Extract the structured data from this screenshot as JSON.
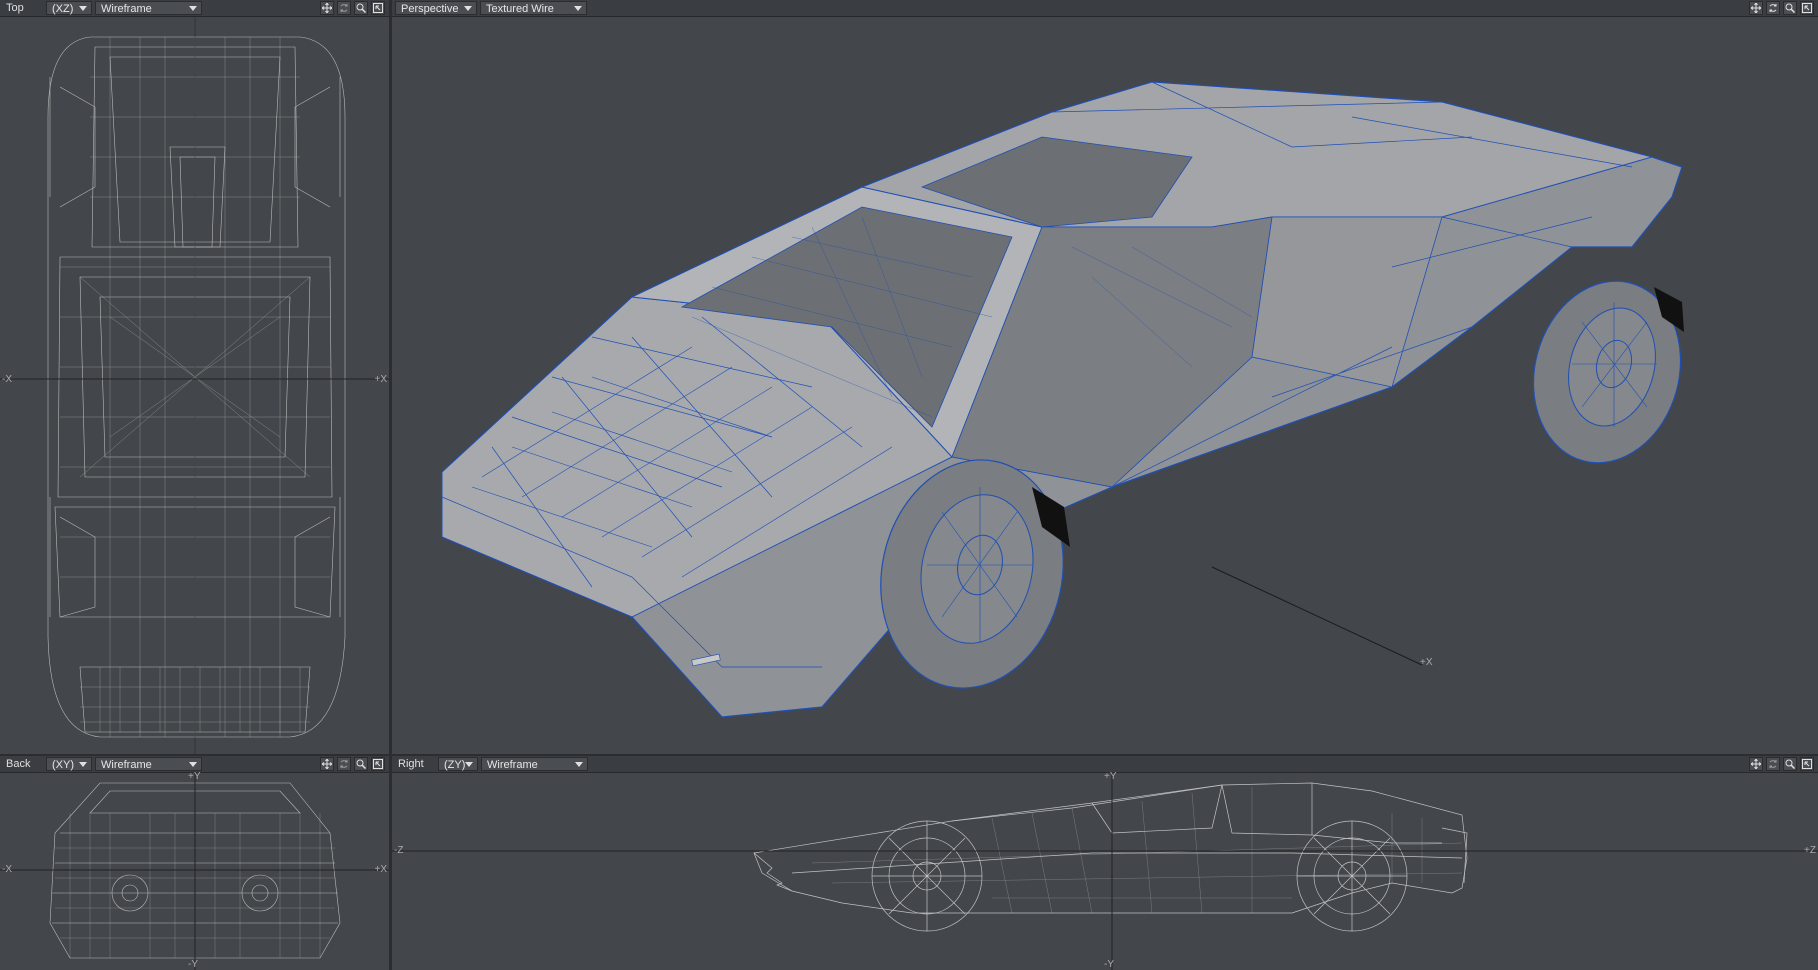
{
  "viewports": {
    "top": {
      "name": "Top",
      "axes": "(XZ)",
      "mode": "Wireframe",
      "labels": {
        "left": "-X",
        "right": "+X"
      }
    },
    "perspective": {
      "name": "Perspective",
      "mode": "Textured Wire",
      "axis_label": "+X"
    },
    "back": {
      "name": "Back",
      "axes": "(XY)",
      "mode": "Wireframe",
      "labels": {
        "top": "+Y",
        "left": "-X",
        "right": "+X",
        "bottom": "-Y"
      }
    },
    "right": {
      "name": "Right",
      "axes": "(ZY)",
      "mode": "Wireframe",
      "labels": {
        "top": "+Y",
        "left": "-Z",
        "right": "+Z",
        "bottom": "-Y"
      }
    }
  },
  "tool_icons": [
    "move-view-icon",
    "rotate-view-icon",
    "zoom-view-icon",
    "maximize-view-icon"
  ],
  "colors": {
    "viewport_bg": "#43474b",
    "header_bg": "#3a3d41",
    "wire": "#d8d8d8",
    "selection_wire": "#1f4fb5",
    "surface": "#a9abae"
  }
}
